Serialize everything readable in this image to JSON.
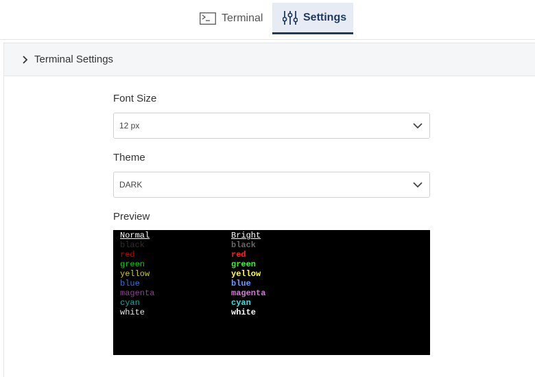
{
  "tabs": {
    "terminal_label": "Terminal",
    "settings_label": "Settings",
    "terminal_icon": "terminal-icon",
    "settings_icon": "sliders-icon"
  },
  "panel": {
    "title": "Terminal Settings",
    "font_size": {
      "label": "Font Size",
      "value": "12 px"
    },
    "theme": {
      "label": "Theme",
      "value": "DARK"
    },
    "preview_label": "Preview"
  },
  "preview": {
    "normal_header": "Normal",
    "bright_header": "Bright",
    "normal": [
      {
        "name": "black",
        "color": "#2e2e2e"
      },
      {
        "name": "red",
        "color": "#cd0000"
      },
      {
        "name": "green",
        "color": "#00cd00"
      },
      {
        "name": "yellow",
        "color": "#cdcd00"
      },
      {
        "name": "blue",
        "color": "#3b6fd8"
      },
      {
        "name": "magenta",
        "color": "#8f3f8f"
      },
      {
        "name": "cyan",
        "color": "#1aa3a3"
      },
      {
        "name": "white",
        "color": "#e5e5e5"
      }
    ],
    "bright": [
      {
        "name": "black",
        "color": "#666666"
      },
      {
        "name": "red",
        "color": "#ff2020"
      },
      {
        "name": "green",
        "color": "#3ef03e"
      },
      {
        "name": "yellow",
        "color": "#ffff3c"
      },
      {
        "name": "blue",
        "color": "#6f97ff"
      },
      {
        "name": "magenta",
        "color": "#d27ad2"
      },
      {
        "name": "cyan",
        "color": "#3fe0e0"
      },
      {
        "name": "white",
        "color": "#ffffff"
      }
    ]
  },
  "colors": {
    "accent": "#1e3a5f",
    "tab_active_bg": "#e7ecf4"
  }
}
